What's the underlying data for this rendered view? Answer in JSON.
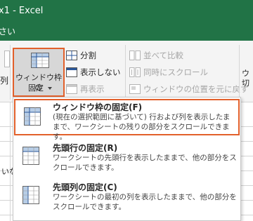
{
  "window": {
    "title": "x1  -  Excel"
  },
  "tellme": {
    "text": "さい"
  },
  "ribbon": {
    "left_fragment": "列",
    "freeze_button": {
      "line1": "ウィンドウ枠の",
      "line2": "固定",
      "icon": "freeze-panes-icon"
    },
    "split": {
      "label": "分割",
      "icon": "split-icon"
    },
    "hide": {
      "label": "表示しない",
      "icon": "hide-window-icon"
    },
    "unhide": {
      "label": "再表示",
      "icon": "unhide-window-icon"
    },
    "view_side_by_side": {
      "label": "並べて比較",
      "icon": "side-by-side-icon"
    },
    "sync_scroll": {
      "label": "同時にスクロール",
      "icon": "sync-scroll-icon"
    },
    "reset_position": {
      "label": "ウィンドウの位置を元に戻す",
      "icon": "reset-window-position-icon"
    },
    "right_fragment": {
      "line1": "ウ",
      "line2": "切"
    }
  },
  "sheet": {
    "cell_fragment": "いな"
  },
  "menu": {
    "items": [
      {
        "title": "ウィンドウ枠の固定(F)",
        "desc": "(現在の選択範囲に基づいて) 行および列を表示したままで、ワークシートの残りの部分をスクロールできます。",
        "icon": "freeze-panes-icon",
        "selected": true
      },
      {
        "title": "先頭行の固定(R)",
        "desc": "ワークシートの先頭行を表示したままで、他の部分をスクロールできます。",
        "icon": "freeze-top-row-icon",
        "selected": false
      },
      {
        "title": "先頭列の固定(C)",
        "desc": "ワークシートの最初の列を表示したままで、他の部分をスクロールできます。",
        "icon": "freeze-first-column-icon",
        "selected": false
      }
    ]
  },
  "colors": {
    "excel_green": "#217346",
    "highlight_orange": "#e2602b",
    "ribbon_bg": "#f4f4f4"
  }
}
